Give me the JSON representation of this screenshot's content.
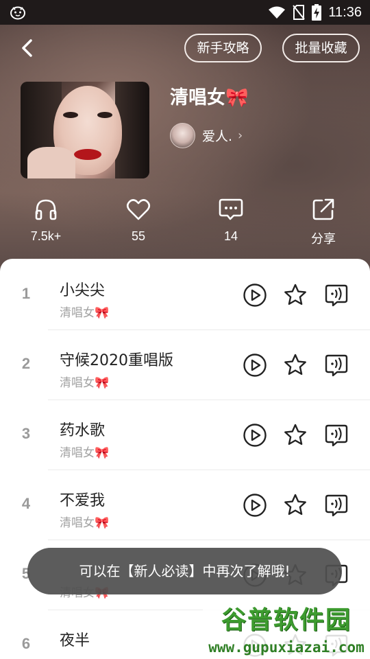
{
  "status_bar": {
    "time": "11:36",
    "icons": [
      "app-icon",
      "wifi-icon",
      "no-sim-icon",
      "battery-charging-icon"
    ]
  },
  "header": {
    "back_icon": "chevron-left-icon",
    "guide_button": "新手攻略",
    "batch_button": "批量收藏"
  },
  "playlist": {
    "title": "清唱女🎀",
    "creator_name": "爱人.",
    "creator_chevron": "›"
  },
  "stats": [
    {
      "icon": "headphones-icon",
      "value": "7.5k+"
    },
    {
      "icon": "heart-icon",
      "value": "55"
    },
    {
      "icon": "comment-icon",
      "value": "14"
    },
    {
      "icon": "share-icon",
      "value": "分享"
    }
  ],
  "songs": [
    {
      "number": "1",
      "title": "小尖尖",
      "artist": "清唱女🎀"
    },
    {
      "number": "2",
      "title": "守候2020重唱版",
      "artist": "清唱女🎀"
    },
    {
      "number": "3",
      "title": "药水歌",
      "artist": "清唱女🎀"
    },
    {
      "number": "4",
      "title": "不爱我",
      "artist": "清唱女🎀"
    },
    {
      "number": "5",
      "title": "",
      "artist": "清唱女🎀"
    },
    {
      "number": "6",
      "title": "夜半",
      "artist": ""
    }
  ],
  "song_actions": [
    "play-circle-icon",
    "star-icon",
    "ringtone-icon"
  ],
  "toast": "可以在【新人必读】中再次了解哦!",
  "watermark": {
    "main": "谷普软件园",
    "url": "www.gupuxiazai.com"
  },
  "colors": {
    "hero_dark": "#4a3a38",
    "hero_mid": "#7a625a",
    "toast_bg": "#505050",
    "watermark_green": "#3d9b2f"
  }
}
